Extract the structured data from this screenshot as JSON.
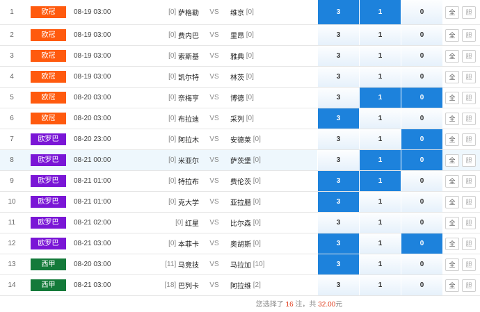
{
  "colors": {
    "ucl": "#ff5a0e",
    "uel": "#7a16d6",
    "laliga": "#147a3a",
    "selected": "#1d82dc"
  },
  "rows": [
    {
      "num": "1",
      "league": "欧冠",
      "league_type": "ucl",
      "time": "08-19 03:00",
      "home_rank": "[0]",
      "home": "萨格勒",
      "away": "维京",
      "away_rank": "[0]",
      "w": "3",
      "d": "1",
      "l": "0",
      "sel": [
        true,
        true,
        false
      ],
      "all": "全",
      "dan": "胆"
    },
    {
      "num": "2",
      "league": "欧冠",
      "league_type": "ucl",
      "time": "08-19 03:00",
      "home_rank": "[0]",
      "home": "费内巴",
      "away": "里昂",
      "away_rank": "[0]",
      "w": "3",
      "d": "1",
      "l": "0",
      "sel": [
        false,
        false,
        false
      ],
      "all": "全",
      "dan": "胆"
    },
    {
      "num": "3",
      "league": "欧冠",
      "league_type": "ucl",
      "time": "08-19 03:00",
      "home_rank": "[0]",
      "home": "索斯基",
      "away": "雅典",
      "away_rank": "[0]",
      "w": "3",
      "d": "1",
      "l": "0",
      "sel": [
        false,
        false,
        false
      ],
      "all": "全",
      "dan": "胆"
    },
    {
      "num": "4",
      "league": "欧冠",
      "league_type": "ucl",
      "time": "08-19 03:00",
      "home_rank": "[0]",
      "home": "凯尔特",
      "away": "林茨",
      "away_rank": "[0]",
      "w": "3",
      "d": "1",
      "l": "0",
      "sel": [
        false,
        false,
        false
      ],
      "all": "全",
      "dan": "胆"
    },
    {
      "num": "5",
      "league": "欧冠",
      "league_type": "ucl",
      "time": "08-20 03:00",
      "home_rank": "[0]",
      "home": "奈梅亨",
      "away": "博德",
      "away_rank": "[0]",
      "w": "3",
      "d": "1",
      "l": "0",
      "sel": [
        false,
        true,
        true
      ],
      "all": "全",
      "dan": "胆"
    },
    {
      "num": "6",
      "league": "欧冠",
      "league_type": "ucl",
      "time": "08-20 03:00",
      "home_rank": "[0]",
      "home": "布拉迪",
      "away": "采列",
      "away_rank": "[0]",
      "w": "3",
      "d": "1",
      "l": "0",
      "sel": [
        true,
        false,
        false
      ],
      "all": "全",
      "dan": "胆"
    },
    {
      "num": "7",
      "league": "欧罗巴",
      "league_type": "uel",
      "time": "08-20 23:00",
      "home_rank": "[0]",
      "home": "阿拉木",
      "away": "安德莱",
      "away_rank": "[0]",
      "w": "3",
      "d": "1",
      "l": "0",
      "sel": [
        false,
        false,
        true
      ],
      "all": "全",
      "dan": "胆"
    },
    {
      "num": "8",
      "league": "欧罗巴",
      "league_type": "uel",
      "time": "08-21 00:00",
      "home_rank": "[0]",
      "home": "米亚尔",
      "away": "萨茨堡",
      "away_rank": "[0]",
      "w": "3",
      "d": "1",
      "l": "0",
      "sel": [
        false,
        true,
        true
      ],
      "all": "全",
      "dan": "胆"
    },
    {
      "num": "9",
      "league": "欧罗巴",
      "league_type": "uel",
      "time": "08-21 01:00",
      "home_rank": "[0]",
      "home": "特拉布",
      "away": "费伦茨",
      "away_rank": "[0]",
      "w": "3",
      "d": "1",
      "l": "0",
      "sel": [
        true,
        true,
        false
      ],
      "all": "全",
      "dan": "胆"
    },
    {
      "num": "10",
      "league": "欧罗巴",
      "league_type": "uel",
      "time": "08-21 01:00",
      "home_rank": "[0]",
      "home": "克大学",
      "away": "亚拉腊",
      "away_rank": "[0]",
      "w": "3",
      "d": "1",
      "l": "0",
      "sel": [
        true,
        false,
        false
      ],
      "all": "全",
      "dan": "胆"
    },
    {
      "num": "11",
      "league": "欧罗巴",
      "league_type": "uel",
      "time": "08-21 02:00",
      "home_rank": "[0]",
      "home": "红星",
      "away": "比尔森",
      "away_rank": "[0]",
      "w": "3",
      "d": "1",
      "l": "0",
      "sel": [
        false,
        false,
        false
      ],
      "all": "全",
      "dan": "胆"
    },
    {
      "num": "12",
      "league": "欧罗巴",
      "league_type": "uel",
      "time": "08-21 03:00",
      "home_rank": "[0]",
      "home": "本菲卡",
      "away": "奥胡斯",
      "away_rank": "[0]",
      "w": "3",
      "d": "1",
      "l": "0",
      "sel": [
        true,
        false,
        true
      ],
      "all": "全",
      "dan": "胆"
    },
    {
      "num": "13",
      "league": "西甲",
      "league_type": "laliga",
      "time": "08-20 03:00",
      "home_rank": "[11]",
      "home": "马竞技",
      "away": "马拉加",
      "away_rank": "[10]",
      "w": "3",
      "d": "1",
      "l": "0",
      "sel": [
        true,
        false,
        false
      ],
      "all": "全",
      "dan": "胆"
    },
    {
      "num": "14",
      "league": "西甲",
      "league_type": "laliga",
      "time": "08-21 03:00",
      "home_rank": "[18]",
      "home": "巴列卡",
      "away": "阿拉维",
      "away_rank": "[2]",
      "w": "3",
      "d": "1",
      "l": "0",
      "sel": [
        false,
        false,
        false
      ],
      "all": "全",
      "dan": "胆"
    }
  ],
  "highlight_row": 8,
  "footer": {
    "prefix": "您选择了",
    "count": "16",
    "mid": "注，共",
    "amount": "32.00",
    "suffix": "元"
  }
}
